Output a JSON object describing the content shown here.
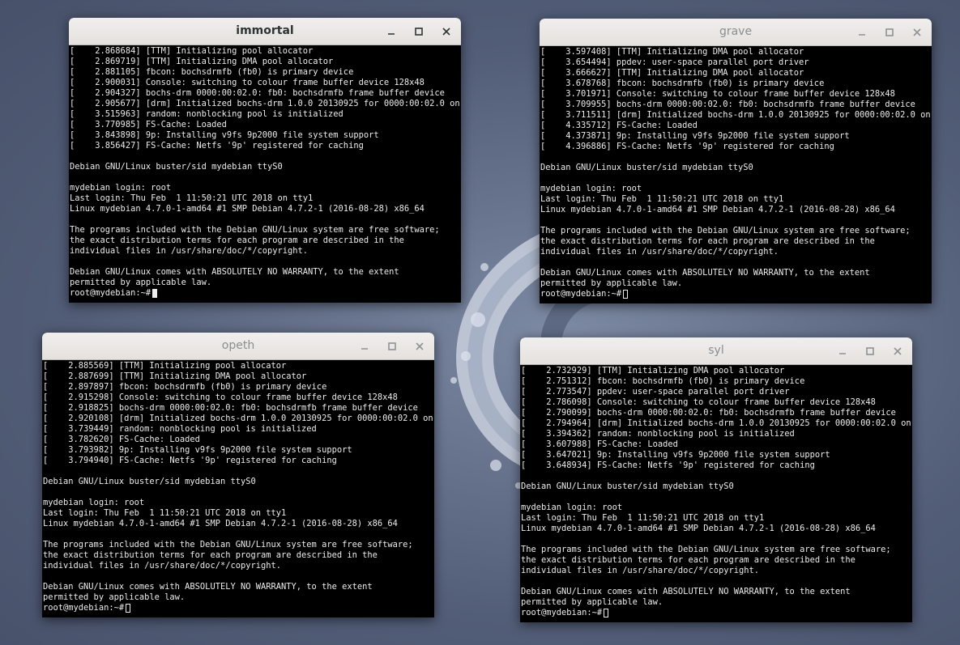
{
  "colors": {
    "titlebar": "#e8e6e3",
    "terminal_bg": "#000000",
    "terminal_fg": "#ececec",
    "desktop": "#5d6983"
  },
  "icons": {
    "minimize": "minimize-icon",
    "maximize": "maximize-icon",
    "close": "close-icon"
  },
  "windows": [
    {
      "title": "immortal",
      "focused": true,
      "lines": [
        "[    2.868684] [TTM] Initializing pool allocator",
        "[    2.869719] [TTM] Initializing DMA pool allocator",
        "[    2.881105] fbcon: bochsdrmfb (fb0) is primary device",
        "[    2.900031] Console: switching to colour frame buffer device 128x48",
        "[    2.904327] bochs-drm 0000:00:02.0: fb0: bochsdrmfb frame buffer device",
        "[    2.905677] [drm] Initialized bochs-drm 1.0.0 20130925 for 0000:00:02.0 on m0",
        "[    3.515963] random: nonblocking pool is initialized",
        "[    3.770985] FS-Cache: Loaded",
        "[    3.843898] 9p: Installing v9fs 9p2000 file system support",
        "[    3.856427] FS-Cache: Netfs '9p' registered for caching",
        "",
        "Debian GNU/Linux buster/sid mydebian ttyS0",
        "",
        "mydebian login: root",
        "Last login: Thu Feb  1 11:50:21 UTC 2018 on tty1",
        "Linux mydebian 4.7.0-1-amd64 #1 SMP Debian 4.7.2-1 (2016-08-28) x86_64",
        "",
        "The programs included with the Debian GNU/Linux system are free software;",
        "the exact distribution terms for each program are described in the",
        "individual files in /usr/share/doc/*/copyright.",
        "",
        "Debian GNU/Linux comes with ABSOLUTELY NO WARRANTY, to the extent",
        "permitted by applicable law."
      ],
      "prompt": "root@mydebian:~#"
    },
    {
      "title": "grave",
      "focused": false,
      "lines": [
        "[    3.597408] [TTM] Initializing DMA pool allocator",
        "[    3.654494] ppdev: user-space parallel port driver",
        "[    3.666627] [TTM] Initializing DMA pool allocator",
        "[    3.678768] fbcon: bochsdrmfb (fb0) is primary device",
        "[    3.701971] Console: switching to colour frame buffer device 128x48",
        "[    3.709955] bochs-drm 0000:00:02.0: fb0: bochsdrmfb frame buffer device",
        "[    3.711511] [drm] Initialized bochs-drm 1.0.0 20130925 for 0000:00:02.0 on m0",
        "[    4.335712] FS-Cache: Loaded",
        "[    4.373871] 9p: Installing v9fs 9p2000 file system support",
        "[    4.396886] FS-Cache: Netfs '9p' registered for caching",
        "",
        "Debian GNU/Linux buster/sid mydebian ttyS0",
        "",
        "mydebian login: root",
        "Last login: Thu Feb  1 11:50:21 UTC 2018 on tty1",
        "Linux mydebian 4.7.0-1-amd64 #1 SMP Debian 4.7.2-1 (2016-08-28) x86_64",
        "",
        "The programs included with the Debian GNU/Linux system are free software;",
        "the exact distribution terms for each program are described in the",
        "individual files in /usr/share/doc/*/copyright.",
        "",
        "Debian GNU/Linux comes with ABSOLUTELY NO WARRANTY, to the extent",
        "permitted by applicable law."
      ],
      "prompt": "root@mydebian:~#"
    },
    {
      "title": "opeth",
      "focused": false,
      "lines": [
        "[    2.885569] [TTM] Initializing pool allocator",
        "[    2.887699] [TTM] Initializing DMA pool allocator",
        "[    2.897897] fbcon: bochsdrmfb (fb0) is primary device",
        "[    2.915298] Console: switching to colour frame buffer device 128x48",
        "[    2.918825] bochs-drm 0000:00:02.0: fb0: bochsdrmfb frame buffer device",
        "[    2.920108] [drm] Initialized bochs-drm 1.0.0 20130925 for 0000:00:02.0 on m0",
        "[    3.739449] random: nonblocking pool is initialized",
        "[    3.782620] FS-Cache: Loaded",
        "[    3.793982] 9p: Installing v9fs 9p2000 file system support",
        "[    3.794940] FS-Cache: Netfs '9p' registered for caching",
        "",
        "Debian GNU/Linux buster/sid mydebian ttyS0",
        "",
        "mydebian login: root",
        "Last login: Thu Feb  1 11:50:21 UTC 2018 on tty1",
        "Linux mydebian 4.7.0-1-amd64 #1 SMP Debian 4.7.2-1 (2016-08-28) x86_64",
        "",
        "The programs included with the Debian GNU/Linux system are free software;",
        "the exact distribution terms for each program are described in the",
        "individual files in /usr/share/doc/*/copyright.",
        "",
        "Debian GNU/Linux comes with ABSOLUTELY NO WARRANTY, to the extent",
        "permitted by applicable law."
      ],
      "prompt": "root@mydebian:~#"
    },
    {
      "title": "syl",
      "focused": false,
      "lines": [
        "[    2.732929] [TTM] Initializing DMA pool allocator",
        "[    2.751312] fbcon: bochsdrmfb (fb0) is primary device",
        "[    2.773547] ppdev: user-space parallel port driver",
        "[    2.786098] Console: switching to colour frame buffer device 128x48",
        "[    2.790099] bochs-drm 0000:00:02.0: fb0: bochsdrmfb frame buffer device",
        "[    2.794964] [drm] Initialized bochs-drm 1.0.0 20130925 for 0000:00:02.0 on m0",
        "[    3.394362] random: nonblocking pool is initialized",
        "[    3.607988] FS-Cache: Loaded",
        "[    3.647021] 9p: Installing v9fs 9p2000 file system support",
        "[    3.648934] FS-Cache: Netfs '9p' registered for caching",
        "",
        "Debian GNU/Linux buster/sid mydebian ttyS0",
        "",
        "mydebian login: root",
        "Last login: Thu Feb  1 11:50:21 UTC 2018 on tty1",
        "Linux mydebian 4.7.0-1-amd64 #1 SMP Debian 4.7.2-1 (2016-08-28) x86_64",
        "",
        "The programs included with the Debian GNU/Linux system are free software;",
        "the exact distribution terms for each program are described in the",
        "individual files in /usr/share/doc/*/copyright.",
        "",
        "Debian GNU/Linux comes with ABSOLUTELY NO WARRANTY, to the extent",
        "permitted by applicable law."
      ],
      "prompt": "root@mydebian:~#"
    }
  ]
}
